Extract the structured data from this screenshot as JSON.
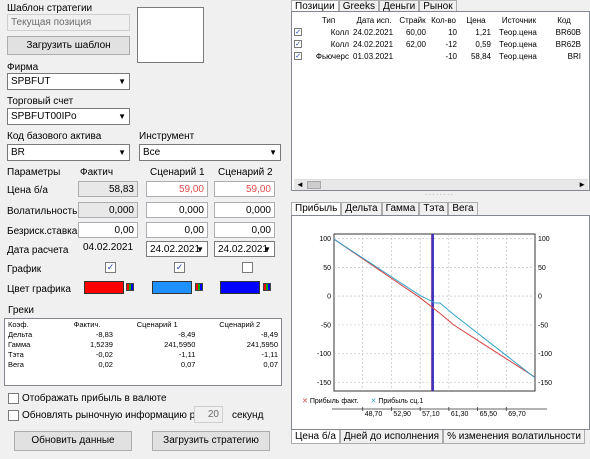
{
  "template": {
    "label": "Шаблон стратегии",
    "current_placeholder": "Текущая позиция",
    "load_button": "Загрузить шаблон"
  },
  "firm": {
    "label": "Фирма",
    "value": "SPBFUT"
  },
  "account": {
    "label": "Торговый счет",
    "value": "SPBFUT00IPo"
  },
  "base_asset": {
    "label": "Код базового актива",
    "value": "BR"
  },
  "instrument": {
    "label": "Инструмент",
    "value": "Все"
  },
  "params": {
    "header_label": "Параметры",
    "col_fact": "Фактич",
    "col_s1": "Сценарий 1",
    "col_s2": "Сценарий 2",
    "price_label": "Цена б/а",
    "price_fact": "58,83",
    "price_s1": "59,00",
    "price_s2": "59,00",
    "vol_label": "Волатильность",
    "vol_fact": "0,000",
    "vol_s1": "0,000",
    "vol_s2": "0,000",
    "rate_label": "Безриск.ставка",
    "rate_fact": "0,00",
    "rate_s1": "0,00",
    "rate_s2": "0,00",
    "date_label": "Дата расчета",
    "date_fact": "04.02.2021",
    "date_s1": "24.02.2021",
    "date_s2": "24.02.2021",
    "chart_label": "График",
    "chart_fact": true,
    "chart_s1": true,
    "chart_s2": false,
    "color_label": "Цвет графика",
    "color_fact": "#ff0000",
    "color_s1": "#1e90ff",
    "color_s2": "#0000ff"
  },
  "greeks": {
    "title": "Греки",
    "headers": [
      "Коэф.",
      "Фактич.",
      "Сценарий 1",
      "Сценарий 2"
    ],
    "rows": [
      [
        "Дельта",
        "-8,83",
        "-8,49",
        "-8,49"
      ],
      [
        "Гамма",
        "1,5239",
        "241,5950",
        "241,5950"
      ],
      [
        "Тэта",
        "-0,02",
        "-1,11",
        "-1,11"
      ],
      [
        "Вега",
        "0,02",
        "0,07",
        "0,07"
      ]
    ]
  },
  "options": {
    "show_currency": "Отображать прибыль в валюте",
    "refresh_label": "Обновлять рыночную информацию раз в",
    "refresh_value": "20",
    "refresh_unit": "секунд"
  },
  "buttons": {
    "update": "Обновить данные",
    "load_strategy": "Загрузить стратегию"
  },
  "top_tabs": [
    "Позиции",
    "Greeks",
    "Деньги",
    "Рынок"
  ],
  "positions": {
    "headers": [
      "Тип",
      "Дата исп.",
      "Страйк",
      "Кол-во",
      "Цена",
      "Источник",
      "Код"
    ],
    "rows": [
      [
        "Колл",
        "24.02.2021",
        "60,00",
        "10",
        "1,21",
        "Теор.цена",
        "BR60B"
      ],
      [
        "Колл",
        "24.02.2021",
        "62,00",
        "-12",
        "0,59",
        "Теор.цена",
        "BR62B"
      ],
      [
        "Фьючерс",
        "01.03.2021",
        "",
        "-10",
        "58,84",
        "Теор.цена",
        "BRI"
      ]
    ]
  },
  "chart_tabs": [
    "Прибыль",
    "Дельта",
    "Гамма",
    "Тэта",
    "Вега"
  ],
  "bottom_tabs": [
    "Цена б/а",
    "Дней до исполнения",
    "% изменения волатильности"
  ],
  "chart_data": {
    "type": "line",
    "x_ticks": [
      "48,70",
      "52,90",
      "57,10",
      "61,30",
      "65,50",
      "69,70"
    ],
    "y_ticks": [
      "100",
      "50",
      "0",
      "-50",
      "-100",
      "-150"
    ],
    "xlim": [
      44.5,
      73.9
    ],
    "ylim": [
      -165,
      108
    ],
    "grid": true,
    "legend": "bottom-left",
    "series": [
      {
        "name": "Прибыль факт.",
        "color": "#d04040",
        "x": [
          44.5,
          57.1,
          60.0,
          62.0,
          73.9
        ],
        "y": [
          99,
          -3,
          -30,
          -50,
          -141
        ]
      },
      {
        "name": "Прибыль сц.1",
        "color": "#36a3c9",
        "x": [
          44.5,
          57.1,
          59.3,
          60.0,
          62.0,
          73.9
        ],
        "y": [
          99,
          1,
          -12,
          -12,
          -32,
          -142
        ]
      }
    ],
    "vlines": [
      {
        "x": 58.83,
        "color": "#7030a0"
      },
      {
        "x": 59.0,
        "color": "#3030c0"
      }
    ]
  }
}
